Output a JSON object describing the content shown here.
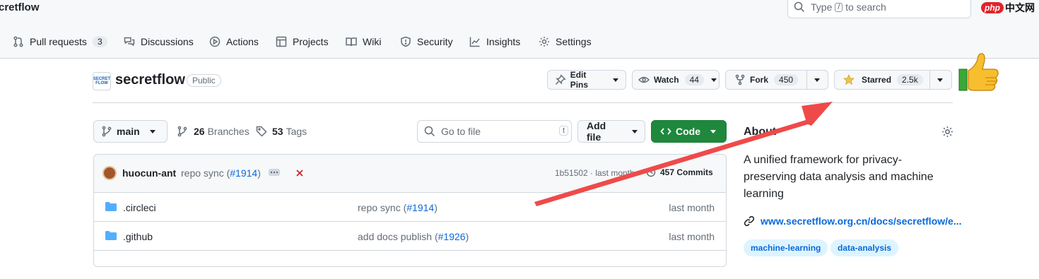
{
  "breadcrumb": "cretflow",
  "search": {
    "prefix": "Type",
    "key": "/",
    "suffix": "to search"
  },
  "watermark": {
    "php": "php",
    "cn": "中文网"
  },
  "nav": [
    {
      "label": "Pull requests",
      "count": "3"
    },
    {
      "label": "Discussions"
    },
    {
      "label": "Actions"
    },
    {
      "label": "Projects"
    },
    {
      "label": "Wiki"
    },
    {
      "label": "Security"
    },
    {
      "label": "Insights"
    },
    {
      "label": "Settings"
    }
  ],
  "repo": {
    "logo_text": "SECRET FLOW",
    "name": "secretflow",
    "visibility": "Public"
  },
  "actions": {
    "edit_pins": "Edit Pins",
    "watch": "Watch",
    "watch_count": "44",
    "fork": "Fork",
    "fork_count": "450",
    "starred": "Starred",
    "star_count": "2.5k"
  },
  "branch_bar": {
    "branch": "main",
    "branches_count": "26",
    "branches_label": "Branches",
    "tags_count": "53",
    "tags_label": "Tags",
    "goto_placeholder": "Go to file",
    "goto_key": "t",
    "add_file": "Add file",
    "code": "Code"
  },
  "commit": {
    "author": "huocun-ant",
    "message": "repo sync (",
    "pr": "#1914",
    "message_end": ")",
    "hash": "1b51502",
    "time": "· last month",
    "commits": "457 Commits"
  },
  "files": [
    {
      "name": ".circleci",
      "msg": "repo sync (",
      "pr": "#1914",
      "msg_end": ")",
      "time": "last month"
    },
    {
      "name": ".github",
      "msg": "add docs publish (",
      "pr": "#1926",
      "msg_end": ")",
      "time": "last month"
    }
  ],
  "about": {
    "heading": "About",
    "description": "A unified framework for privacy-preserving data analysis and machine learning",
    "website": "www.secretflow.org.cn/docs/secretflow/e...",
    "topics": [
      "machine-learning",
      "data-analysis"
    ]
  },
  "colors": {
    "code_button": "#1f883d",
    "arrow": "#ef4a4a",
    "link": "#0969da",
    "star": "#eac54f"
  }
}
